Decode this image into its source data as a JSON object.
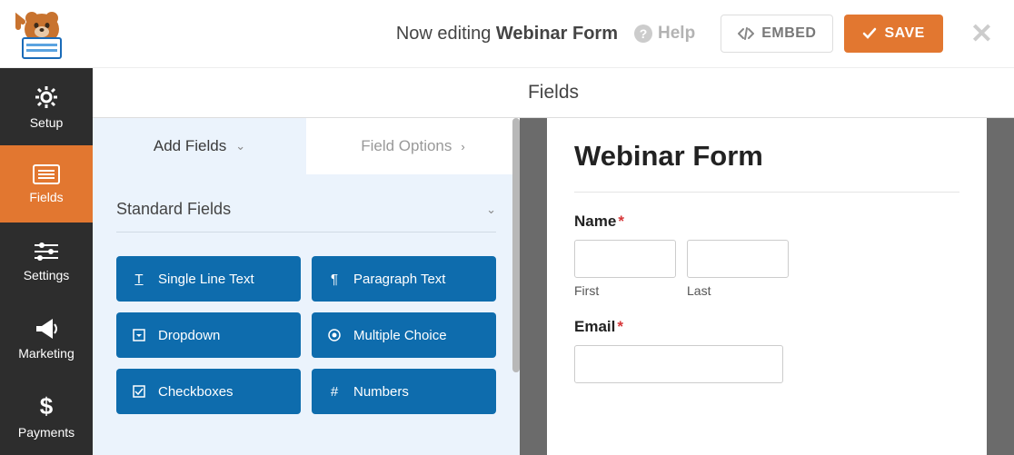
{
  "header": {
    "editing_prefix": "Now editing ",
    "form_name": "Webinar Form",
    "help_label": "Help",
    "embed_label": "EMBED",
    "save_label": "SAVE"
  },
  "sidebar": {
    "items": [
      {
        "label": "Setup"
      },
      {
        "label": "Fields"
      },
      {
        "label": "Settings"
      },
      {
        "label": "Marketing"
      },
      {
        "label": "Payments"
      }
    ]
  },
  "panel": {
    "title": "Fields",
    "tabs": {
      "add": "Add Fields",
      "options": "Field Options"
    },
    "section_title": "Standard Fields",
    "fields": [
      {
        "label": "Single Line Text"
      },
      {
        "label": "Paragraph Text"
      },
      {
        "label": "Dropdown"
      },
      {
        "label": "Multiple Choice"
      },
      {
        "label": "Checkboxes"
      },
      {
        "label": "Numbers"
      }
    ]
  },
  "preview": {
    "form_title": "Webinar Form",
    "name_label": "Name",
    "first_label": "First",
    "last_label": "Last",
    "email_label": "Email",
    "required_mark": "*"
  }
}
